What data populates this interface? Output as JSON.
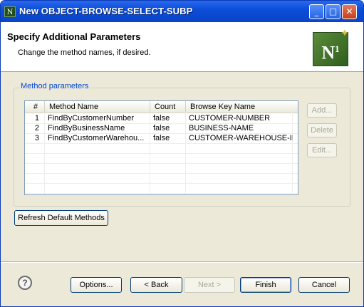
{
  "window": {
    "icon_glyph": "N",
    "title": "New OBJECT-BROWSE-SELECT-SUBP",
    "minimize_glyph": "_",
    "maximize_glyph": "□",
    "close_glyph": "✕"
  },
  "header": {
    "title": "Specify Additional Parameters",
    "description": "Change the method names, if desired.",
    "logo_text": "N",
    "logo_sup": "1",
    "logo_star": "✦"
  },
  "group": {
    "label": "Method parameters"
  },
  "table": {
    "columns": [
      "#",
      "Method Name",
      "Count",
      "Browse Key Name"
    ],
    "rows": [
      {
        "num": "1",
        "method": "FindByCustomerNumber",
        "count": "false",
        "key": "CUSTOMER-NUMBER"
      },
      {
        "num": "2",
        "method": "FindByBusinessName",
        "count": "false",
        "key": "BUSINESS-NAME"
      },
      {
        "num": "3",
        "method": "FindByCustomerWarehou...",
        "count": "false",
        "key": "CUSTOMER-WAREHOUSE-ID"
      }
    ]
  },
  "side_buttons": {
    "add": "Add...",
    "delete": "Delete",
    "edit": "Edit..."
  },
  "refresh_label": "Refresh Default Methods",
  "footer": {
    "help_glyph": "?",
    "options": "Options...",
    "back": "< Back",
    "next": "Next >",
    "finish": "Finish",
    "cancel": "Cancel"
  }
}
